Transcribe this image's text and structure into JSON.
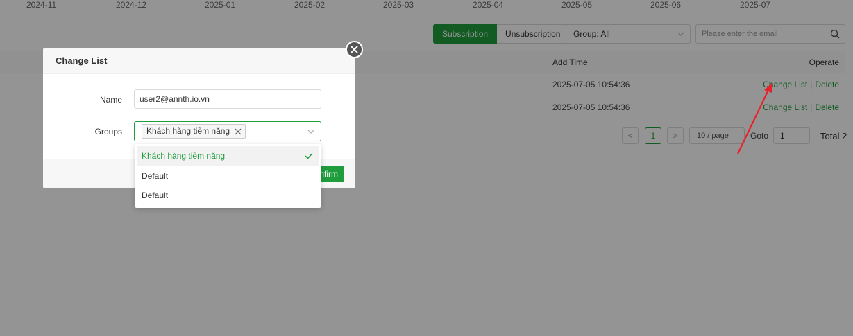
{
  "months": [
    "2024-11",
    "2024-12",
    "2025-01",
    "2025-02",
    "2025-03",
    "2025-04",
    "2025-05",
    "2025-06",
    "2025-07"
  ],
  "toolbar": {
    "subscription_label": "Subscription",
    "unsubscription_label": "Unsubscription",
    "group_filter_value": "Group: All",
    "email_search_placeholder": "Please enter the email"
  },
  "table": {
    "columns": {
      "add_time": "Add Time",
      "operate": "Operate"
    },
    "rows": [
      {
        "add_time": "2025-07-05 10:54:36",
        "change_label": "Change List",
        "delete_label": "Delete"
      },
      {
        "add_time": "2025-07-05 10:54:36",
        "change_label": "Change List",
        "delete_label": "Delete"
      }
    ]
  },
  "pagination": {
    "prev": "<",
    "current_page": "1",
    "next": ">",
    "page_size": "10 / page",
    "goto_label": "Goto",
    "goto_value": "1",
    "total": "Total 2"
  },
  "modal": {
    "title": "Change List",
    "name_label": "Name",
    "name_value": "user2@annth.io.vn",
    "groups_label": "Groups",
    "selected_tag": "Khách hàng tiềm năng",
    "confirm_label": "nfirm"
  },
  "dropdown": {
    "options": [
      "Khách hàng tiềm năng",
      "Default",
      "Default"
    ],
    "selected_index": 0
  },
  "colors": {
    "accent": "#1f9d3c",
    "arrow": "#e8202a"
  }
}
